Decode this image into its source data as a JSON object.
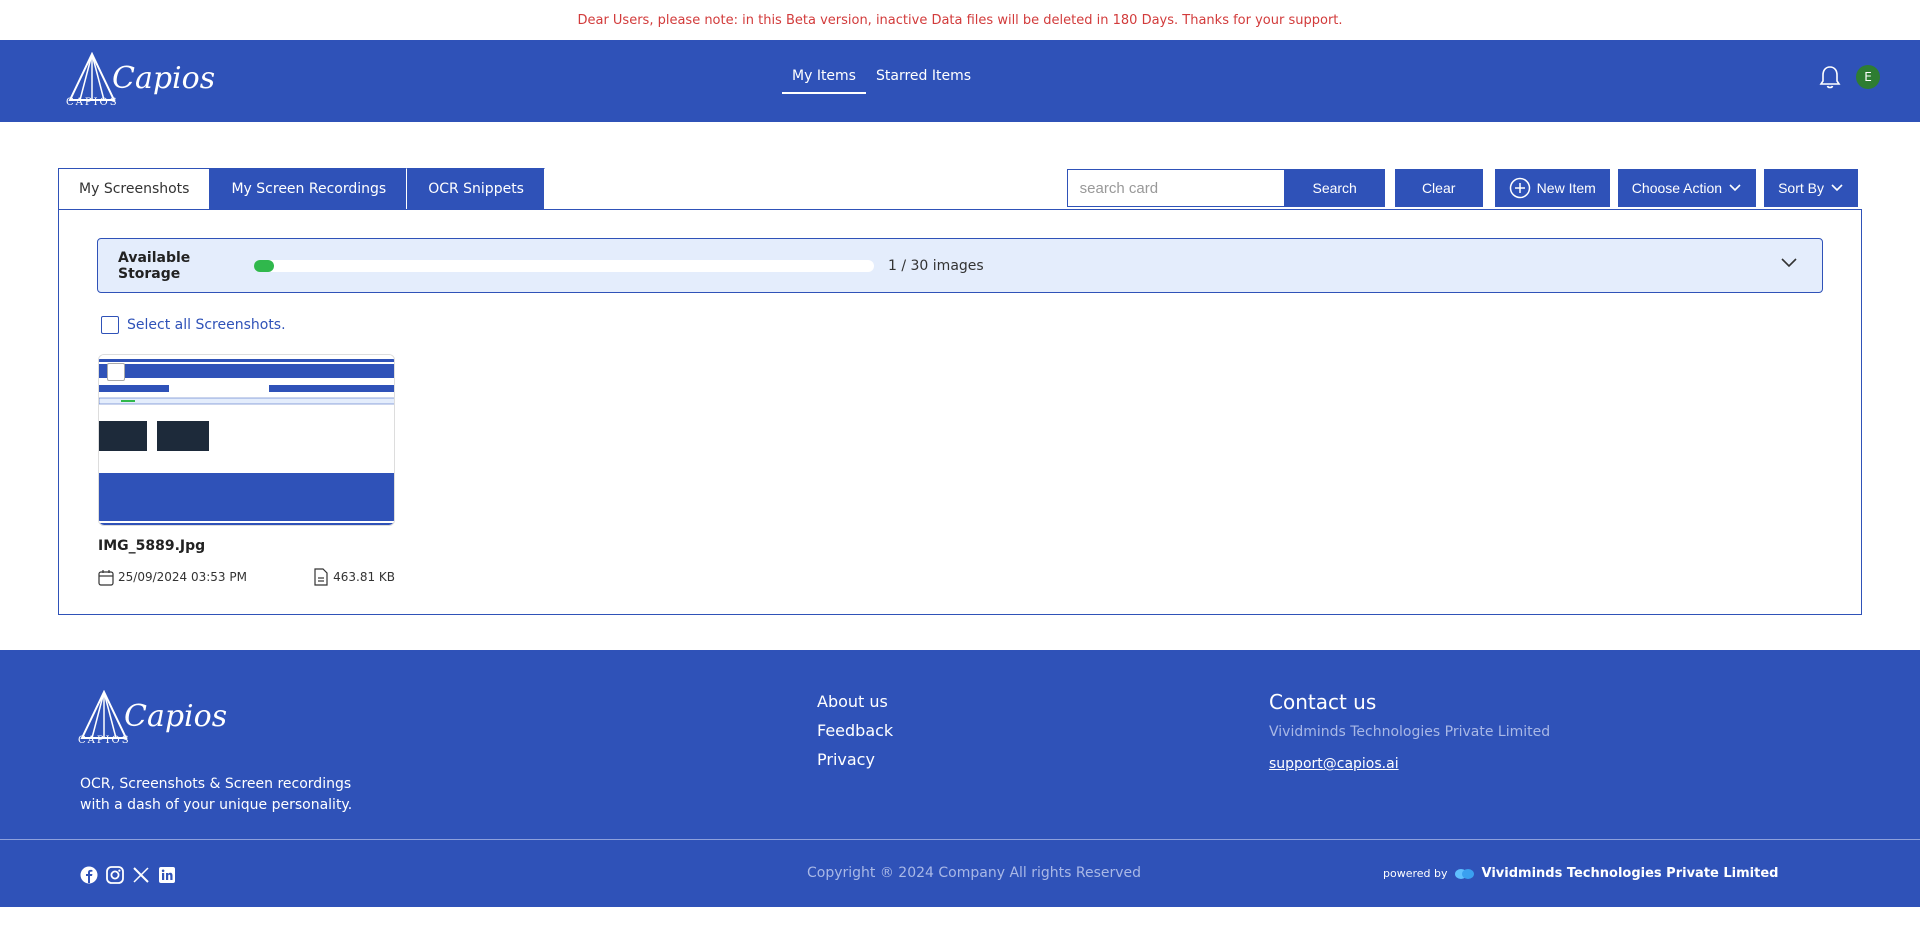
{
  "banner": {
    "text": "Dear Users, please note: in this Beta version, inactive Data files will be deleted in 180 Days. Thanks for your support."
  },
  "header": {
    "logo_word": "Capios",
    "logo_sub": "CAPIOS",
    "nav": [
      {
        "label": "My Items",
        "active": true
      },
      {
        "label": "Starred Items",
        "active": false
      }
    ],
    "avatar_initial": "E"
  },
  "tabs": [
    {
      "label": "My Screenshots",
      "active": true
    },
    {
      "label": "My Screen Recordings",
      "active": false
    },
    {
      "label": "OCR Snippets",
      "active": false
    }
  ],
  "toolbar": {
    "search_placeholder": "search card",
    "search_label": "Search",
    "clear_label": "Clear",
    "new_item_label": "New Item",
    "choose_action_label": "Choose Action",
    "sort_by_label": "Sort By"
  },
  "storage": {
    "label": "Available Storage",
    "used": 1,
    "total": 30,
    "fill_fraction": 0.033,
    "count_text": "1 / 30 images"
  },
  "select_all_label": "Select all Screenshots.",
  "cards": [
    {
      "title": "IMG_5889.Jpg",
      "date": "25/09/2024 03:53 PM",
      "size": "463.81 KB"
    }
  ],
  "footer": {
    "tagline": "OCR, Screenshots & Screen recordings with a dash of your unique personality.",
    "links": [
      "About us",
      "Feedback",
      "Privacy"
    ],
    "contact_title": "Contact us",
    "company": "Vividminds Technologies Private Limited",
    "email": "support@capios.ai",
    "copyright": "Copyright ® 2024 Company All rights Reserved",
    "powered_by": "powered by",
    "powered_company": "Vividminds Technologies Private Limited"
  },
  "colors": {
    "brand": "#2f52b8",
    "banner_text": "#d23b3b",
    "storage_fill": "#30b84c",
    "avatar": "#2e7d32"
  }
}
